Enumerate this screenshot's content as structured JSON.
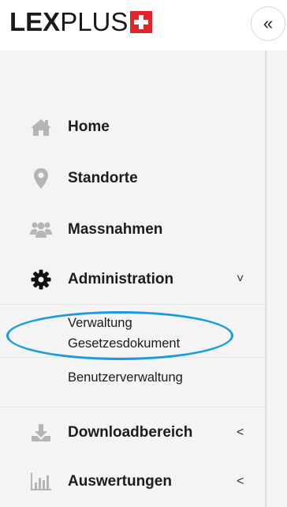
{
  "header": {
    "logo_lex": "LEX",
    "logo_plus": "PLUS",
    "collapse_label": "«"
  },
  "sidebar": {
    "items": [
      {
        "label": "Home",
        "icon": "home-icon"
      },
      {
        "label": "Standorte",
        "icon": "location-pin-icon"
      },
      {
        "label": "Massnahmen",
        "icon": "users-icon"
      },
      {
        "label": "Administration",
        "icon": "gear-icon",
        "chevron": "˅"
      },
      {
        "label": "Downloadbereich",
        "icon": "download-icon",
        "chevron": "<"
      },
      {
        "label": "Auswertungen",
        "icon": "bar-chart-icon",
        "chevron": "<"
      }
    ],
    "admin_subitems": [
      {
        "line1": "Verwaltung",
        "line2": "Gesetzesdokument"
      },
      {
        "line1": "Benutzerverwaltung"
      }
    ]
  },
  "colors": {
    "brand_red": "#e2242b",
    "sidebar_bg": "#f4f4f4",
    "highlight": "#1a9be0",
    "inactive_icon": "#b5b5b5"
  }
}
